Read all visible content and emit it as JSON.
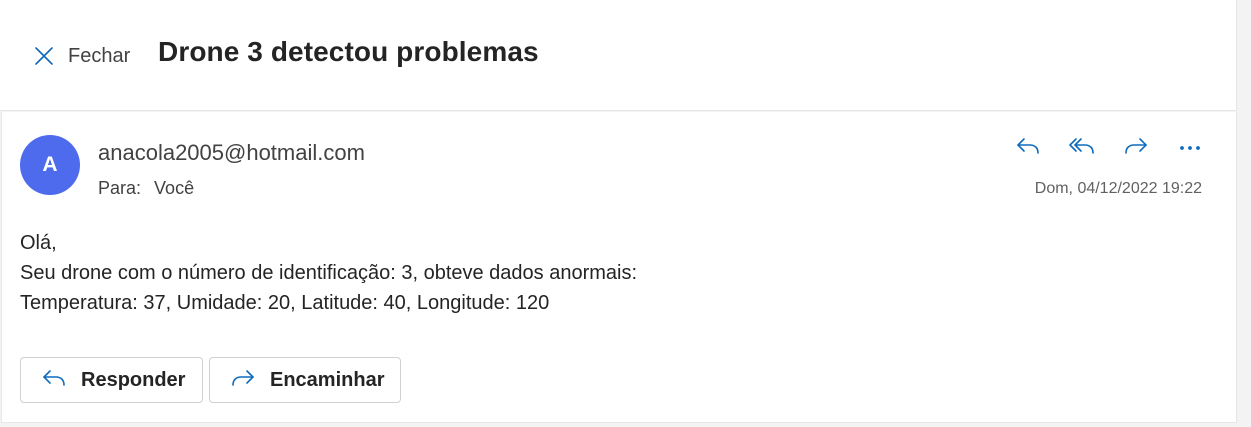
{
  "header": {
    "close_label": "Fechar",
    "subject": "Drone 3 detectou problemas"
  },
  "message": {
    "avatar_initial": "A",
    "avatar_color": "#4f6bed",
    "sender": "anacola2005@hotmail.com",
    "to_label": "Para:",
    "to_value": "Você",
    "date": "Dom, 04/12/2022 19:22",
    "actions": [
      "reply-icon",
      "reply-all-icon",
      "forward-icon",
      "more-icon"
    ],
    "body": [
      "Olá,",
      "Seu drone com o número de identificação: 3, obteve dados anormais:",
      "Temperatura: 37, Umidade: 20, Latitude: 40, Longitude: 120"
    ]
  },
  "buttons": {
    "reply_label": "Responder",
    "forward_label": "Encaminhar"
  },
  "colors": {
    "accent": "#0f6cbd",
    "background": "#f3f3f3",
    "card": "#ffffff"
  }
}
